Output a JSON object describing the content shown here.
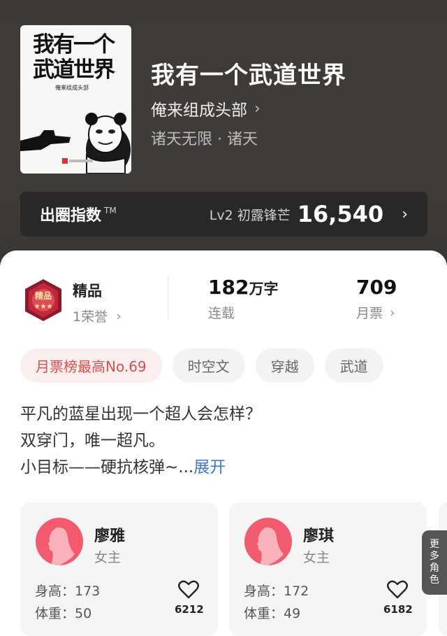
{
  "book": {
    "cover_title": "我有一个武道世界",
    "cover_author": "俺来组成头部",
    "title": "我有一个武道世界",
    "author": "俺来组成头部",
    "genre": "诸天无限 · 诸天"
  },
  "fan_index": {
    "label": "出圈指数",
    "tm": "TM",
    "level": "Lv2 初露锋芒",
    "value": "16,540"
  },
  "stats": {
    "quality_label": "精品",
    "honor": "1荣誉",
    "words_num": "182",
    "words_unit": "万字",
    "status": "连载",
    "votes": "709",
    "votes_label": "月票"
  },
  "tags": [
    {
      "label": "月票榜最高No.69"
    },
    {
      "label": "时空文"
    },
    {
      "label": "穿越"
    },
    {
      "label": "武道"
    }
  ],
  "synopsis": {
    "line1": "平凡的蓝星出现一个超人会怎样？",
    "line2": "双穿门，唯一超凡。",
    "line3": "小目标——硬抗核弹~...",
    "expand": "展开"
  },
  "characters": [
    {
      "name": "廖雅",
      "role": "女主",
      "height": "身高：173",
      "weight": "体重：50",
      "likes": "6212"
    },
    {
      "name": "廖琪",
      "role": "女主",
      "height": "身高：172",
      "weight": "体重：49",
      "likes": "6182"
    }
  ],
  "more_roles": "更多角色",
  "colors": {
    "accent_red": "#d94f4f",
    "link_blue": "#3d78c9",
    "avatar_pink": "#f25a6e",
    "hero_bg": "#3c3937"
  }
}
